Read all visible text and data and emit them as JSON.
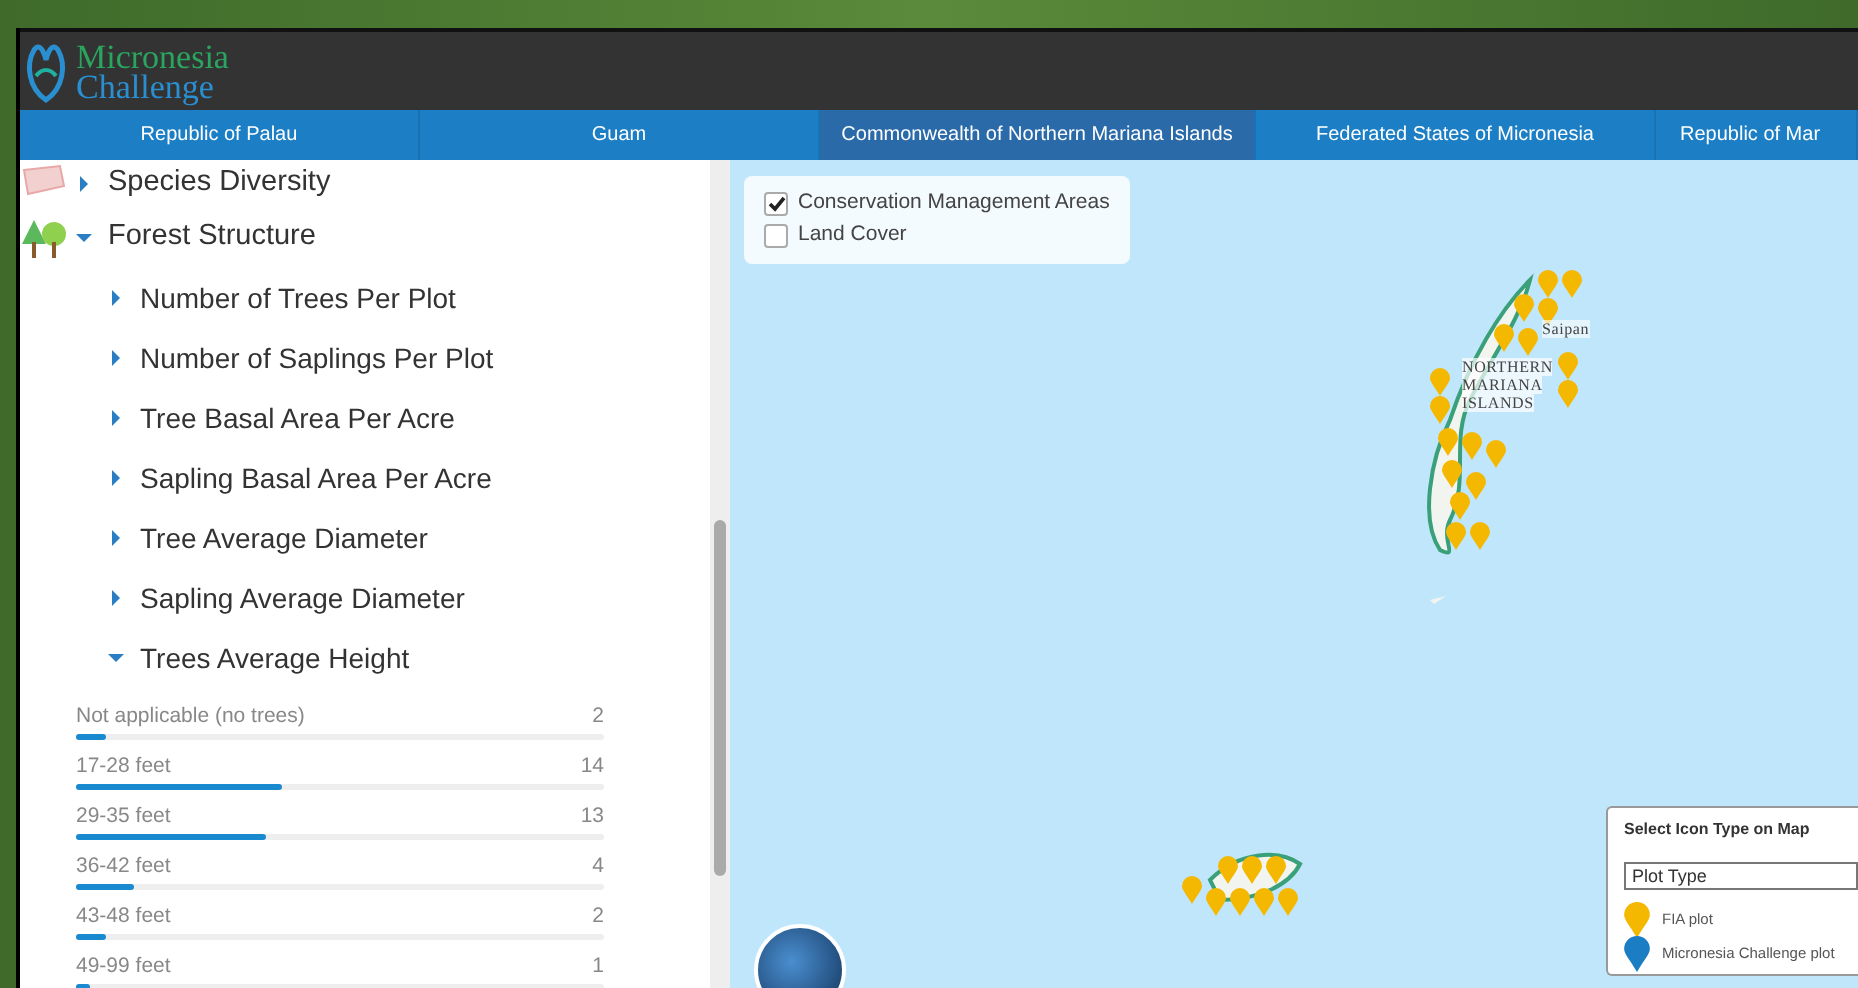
{
  "header": {
    "logo_line_1": "Micronesia",
    "logo_line_2": "Challenge"
  },
  "tabs": [
    {
      "label": "Republic of Palau",
      "selected": false
    },
    {
      "label": "Guam",
      "selected": false
    },
    {
      "label": "Commonwealth of Northern Mariana Islands",
      "selected": true
    },
    {
      "label": "Federated States of Micronesia",
      "selected": false
    },
    {
      "label": "Republic of Mar",
      "selected": false
    }
  ],
  "sidebar": {
    "items": [
      {
        "label": "Species Diversity",
        "kind": "category",
        "expanded": false
      },
      {
        "label": "Forest Structure",
        "kind": "category",
        "expanded": true,
        "children": [
          {
            "label": "Number of Trees Per Plot",
            "expanded": false
          },
          {
            "label": "Number of Saplings Per Plot",
            "expanded": false
          },
          {
            "label": "Tree Basal Area Per Acre",
            "expanded": false
          },
          {
            "label": "Sapling Basal Area Per Acre",
            "expanded": false
          },
          {
            "label": "Tree Average Diameter",
            "expanded": false
          },
          {
            "label": "Sapling Average Diameter",
            "expanded": false
          },
          {
            "label": "Trees Average Height",
            "expanded": true,
            "bins": [
              {
                "label": "Not applicable (no trees)",
                "count": "2",
                "level": 0.055
              },
              {
                "label": "17-28 feet",
                "count": "14",
                "level": 0.39
              },
              {
                "label": "29-35 feet",
                "count": "13",
                "level": 0.36
              },
              {
                "label": "36-42 feet",
                "count": "4",
                "level": 0.11
              },
              {
                "label": "43-48 feet",
                "count": "2",
                "level": 0.055
              },
              {
                "label": "49-99 feet",
                "count": "1",
                "level": 0.028
              }
            ]
          }
        ]
      }
    ]
  },
  "map": {
    "layers": [
      {
        "label": "Conservation Management Areas",
        "checked": true
      },
      {
        "label": "Land Cover",
        "checked": false
      }
    ],
    "labels": [
      "Saipan",
      "NORTHERN",
      "MARIANA",
      "ISLANDS"
    ],
    "legend": {
      "title": "Select Icon Type on Map",
      "select_value": "Plot Type",
      "entries": [
        {
          "label": "FIA plot",
          "color": "#f5b800"
        },
        {
          "label": "Micronesia Challenge plot",
          "color": "#1b7dc4"
        }
      ]
    }
  }
}
